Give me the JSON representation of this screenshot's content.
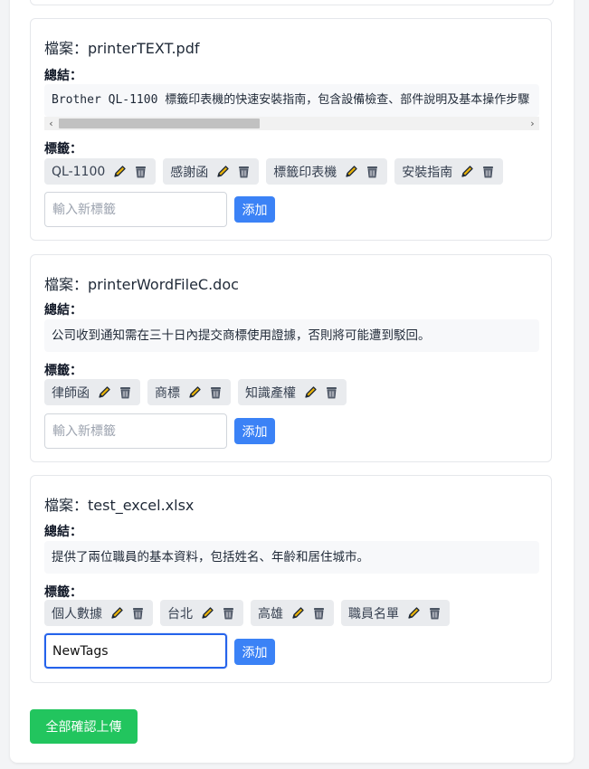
{
  "files": [
    {
      "file_label": "檔案：printerTEXT.pdf",
      "summary_label": "總結：",
      "summary": "Brother QL-1100 標籤印表機的快速安裝指南，包含設備檢查、部件說明及基本操作步驟",
      "tags_label": "標籤：",
      "tags": [
        "QL-1100",
        "感謝函",
        "標籤印表機",
        "安裝指南"
      ],
      "new_tag_value": "",
      "new_tag_placeholder": "輸入新標籤",
      "add_label": "添加"
    },
    {
      "file_label": "檔案：printerWordFileC.doc",
      "summary_label": "總結：",
      "summary": "公司收到通知需在三十日內提交商標使用證據，否則將可能遭到駁回。",
      "tags_label": "標籤：",
      "tags": [
        "律師函",
        "商標",
        "知識產權"
      ],
      "new_tag_value": "",
      "new_tag_placeholder": "輸入新標籤",
      "add_label": "添加"
    },
    {
      "file_label": "檔案：test_excel.xlsx",
      "summary_label": "總結：",
      "summary": "提供了兩位職員的基本資料，包括姓名、年齡和居住城市。",
      "tags_label": "標籤：",
      "tags": [
        "個人數據",
        "台北",
        "高雄",
        "職員名單"
      ],
      "new_tag_value": "NewTags",
      "new_tag_placeholder": "輸入新標籤",
      "add_label": "添加"
    }
  ],
  "confirm_all_label": "全部確認上傳",
  "colors": {
    "add_button": "#3b82f6",
    "confirm_button": "#22c55e",
    "edit_icon": "#eab308",
    "delete_icon": "#4b5563"
  },
  "icons": {
    "edit": "pencil-icon",
    "delete": "trash-icon"
  }
}
